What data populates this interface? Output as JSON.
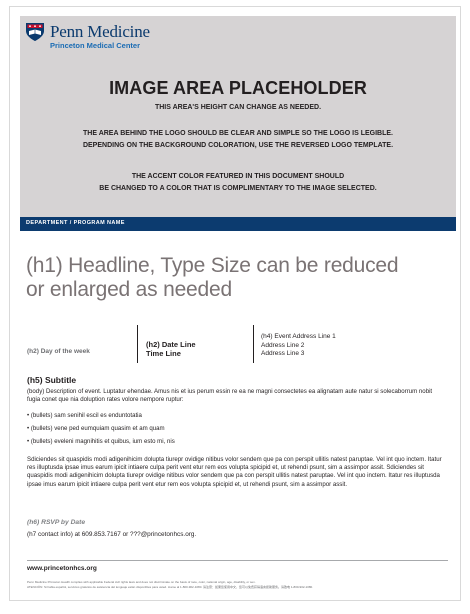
{
  "logo": {
    "name": "Penn Medicine",
    "subtitle": "Princeton Medical Center",
    "colors": {
      "navy": "#0b3a6e",
      "blue": "#1b6cb4",
      "red": "#c8102e"
    }
  },
  "image_area": {
    "title": "IMAGE AREA PLACEHOLDER",
    "line1": "THIS AREA'S HEIGHT CAN CHANGE AS NEEDED.",
    "line2": "THE AREA BEHIND THE LOGO SHOULD BE CLEAR AND SIMPLE SO THE LOGO IS LEGIBLE.",
    "line3": "DEPENDING ON THE BACKGROUND COLORATION, USE THE REVERSED LOGO TEMPLATE.",
    "line4": "THE ACCENT COLOR FEATURED IN THIS DOCUMENT SHOULD",
    "line5": "BE CHANGED TO A COLOR THAT IS COMPLIMENTARY TO THE IMAGE SELECTED."
  },
  "band": {
    "label": "DEPARTMENT / PROGRAM NAME",
    "color": "#0c3b6f"
  },
  "headline": {
    "line1": "(h1) Headline, Type Size can be reduced",
    "line2": "or enlarged as needed"
  },
  "meta": {
    "day": "(h2) Day of the week",
    "date_line": "(h2) Date Line",
    "time_line": "Time Line",
    "address1": "(h4) Event Address Line 1",
    "address2": "Address Line 2",
    "address3": "Address Line 3"
  },
  "subtitle": "(h5) Subtitle",
  "body1": "(body) Description of event. Luptatur ehendae. Amus nis et ius perum essin re ea ne magni consectetes ea alignatam aute natur si solecaborrum nobit fugia conet que nia doluption rates volore nempore ruptur:",
  "bullets": [
    "• (bullets) sam senihil escil es enduntotatia",
    "• (bullets) vene ped eumquiam quasim et am quam",
    "• (bullets) eveleni magnihitis et quibus, ium esto mi, nis"
  ],
  "body2": "Sdiciendes sit quaspidis modi adigenihicim dolupta tiurepr ovidige nitibus volor sendem que pa con perspit ullitis natest paruptae. Vel int quo inctem. Itatur res illuptusda ipsae imus earum ipicit intiaere culpa perit vent etur rem eos volupta spicipid et, ut rehendi psunt, sim a assimpor assit. Sdiciendes sit quaspidis modi adigenihicim dolupta tiurepr ovidige nitibus volor sendem que pa con perspit ullitis natest paruptae. Vel int quo inctem. Itatur res illuptusda ipsae imus earum ipicit intiaere culpa perit vent etur rem eos volupta spicipid et, ut rehendi psunt, sim a assimpor assit.",
  "rsvp": "(h6) RSVP by Date",
  "contact": "(h7 contact info) at 609.853.7167 or ???@princetonhcs.org.",
  "footer": {
    "url": "www.princetonhcs.org",
    "fine1": "Penn Medicine Princeton Health complies with applicable Federal civil rights laws and does not discriminate on the basis of race, color, national origin, age, disability, or sex.",
    "fine2": "ATENCIÓN: Si habla español, servicios gratuitos de asistencia del lenguaje están disponibles para usted. Llame al 1-800-902-1080. 请注意：如果您使用中文，您可以免费获得语言援助服务。请致电 1-800-902-1080."
  }
}
